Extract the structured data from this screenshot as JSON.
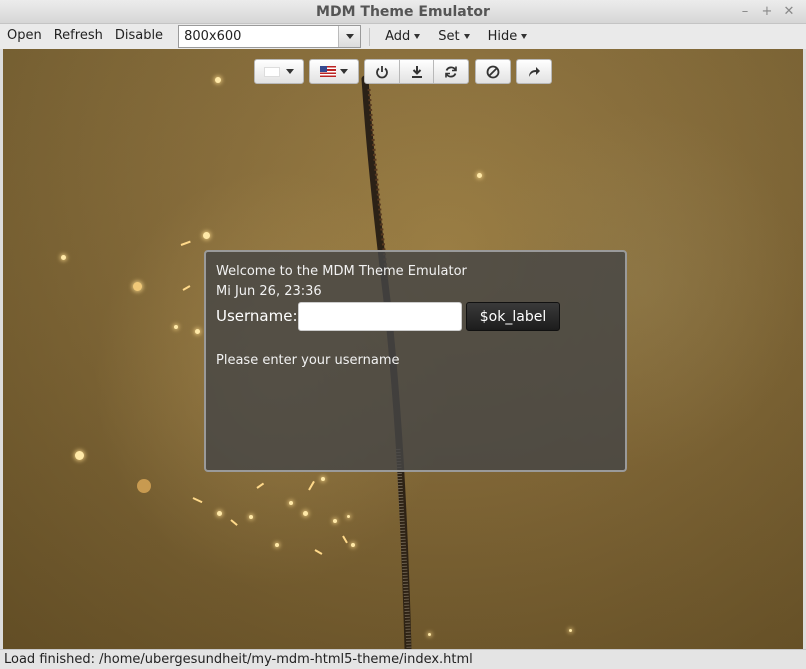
{
  "window": {
    "title": "MDM Theme Emulator",
    "controls": [
      "minimize-icon",
      "maximize-icon",
      "close-icon"
    ]
  },
  "menubar": {
    "open_label": "Open",
    "refresh_label": "Refresh",
    "disable_label": "Disable",
    "resolution_value": "800x600",
    "add_label": "Add",
    "set_label": "Set",
    "hide_label": "Hide"
  },
  "toolbar": {
    "buttons": [
      "color-select",
      "language-flag-select",
      "power-icon",
      "download-icon",
      "refresh-icon",
      "cancel-icon",
      "forward-icon"
    ]
  },
  "login": {
    "welcome_text": "Welcome to the MDM Theme Emulator",
    "clock_text": "Mi Jun 26, 23:36",
    "username_label": "Username:",
    "username_value": "",
    "ok_label": "$ok_label",
    "message": "Please enter your username"
  },
  "status": {
    "text": "Load finished: /home/ubergesundheit/my-mdm-html5-theme/index.html"
  },
  "colors": {
    "panel_bg": "#464646",
    "panel_border": "#9a9a9a",
    "ok_button_bg": "#262626",
    "background_tone": "#8f7440"
  }
}
